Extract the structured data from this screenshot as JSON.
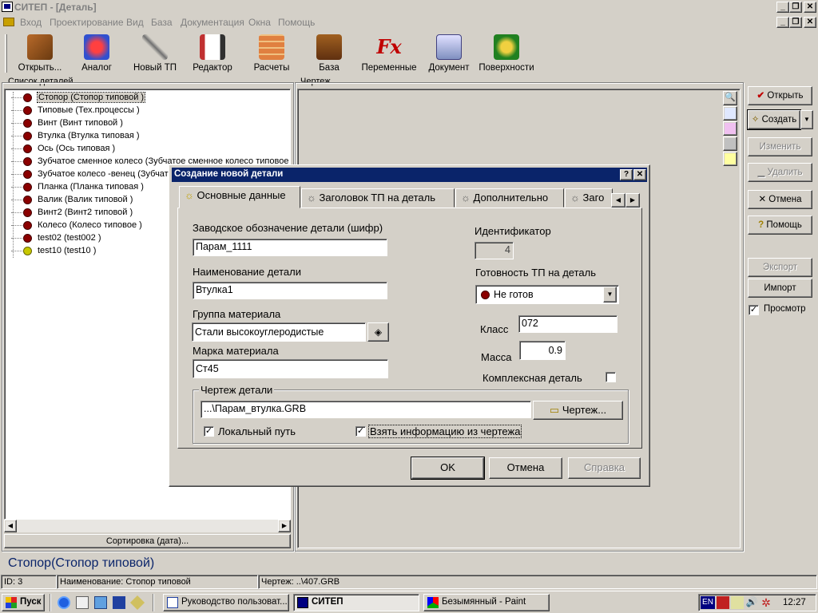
{
  "window": {
    "title": "СИТЕП - [Деталь]"
  },
  "menu": [
    "Вход",
    "Проектирование",
    "Вид",
    "База",
    "Документация",
    "Окна",
    "Помощь"
  ],
  "toolbar": [
    "Открыть...",
    "Аналог",
    "Новый ТП",
    "Редактор",
    "Расчеты",
    "База",
    "Переменные",
    "Документ",
    "Поверхности"
  ],
  "left_panel": {
    "title": "Список деталей",
    "items": [
      {
        "label": "Стопор (Стопор типовой )",
        "status": "red"
      },
      {
        "label": "Типовые (Тех.процессы )",
        "status": "red"
      },
      {
        "label": "Винт (Винт типовой )",
        "status": "red"
      },
      {
        "label": "Втулка (Втулка типовая )",
        "status": "red"
      },
      {
        "label": "Ось (Ось типовая )",
        "status": "red"
      },
      {
        "label": "Зубчатое сменное колесо (Зубчатое сменное колесо типовое",
        "status": "red"
      },
      {
        "label": "Зубчатое колесо -венец (Зубчато",
        "status": "red"
      },
      {
        "label": "Планка (Планка типовая )",
        "status": "red"
      },
      {
        "label": "Валик (Валик типовой )",
        "status": "red"
      },
      {
        "label": "Винт2 (Винт2 типовой )",
        "status": "red"
      },
      {
        "label": "Колесо (Колесо типовое )",
        "status": "red"
      },
      {
        "label": "test02 (test002 )",
        "status": "red"
      },
      {
        "label": "test10 (test10 )",
        "status": "yellow"
      }
    ],
    "sort_button": "Сортировка (дата)..."
  },
  "center_panel": {
    "title": "Чертеж"
  },
  "right_buttons": {
    "open": "Открыть",
    "create": "Создать",
    "change": "Изменить",
    "delete": "Удалить",
    "cancel": "Отмена",
    "help": "Помощь",
    "export": "Экспорт",
    "import": "Импорт",
    "preview": "Просмотр"
  },
  "dialog": {
    "title": "Создание новой детали",
    "tabs": [
      "Основные данные",
      "Заголовок ТП на деталь",
      "Дополнительно",
      "Заго"
    ],
    "code_label": "Заводское обозначение детали (шифр)",
    "code_value": "Парам_1111",
    "id_label": "Идентификатор",
    "id_value": "4",
    "name_label": "Наименование детали",
    "name_value": "Втулка1",
    "readiness_label": "Готовность ТП на деталь",
    "readiness_value": "Не готов",
    "group_label": "Группа материала",
    "group_value": "Стали высокоуглеродистые",
    "class_label": "Класс",
    "class_value": "072",
    "grade_label": "Марка материала",
    "grade_value": "Ст45",
    "mass_label": "Масса",
    "mass_value": "0.9",
    "complex_label": "Комплексная деталь",
    "drawing_group": "Чертеж детали",
    "drawing_path": "...\\Парам_втулка.GRB",
    "drawing_button": "Чертеж...",
    "local_path": "Локальный путь",
    "take_info": "Взять информацию из чертежа",
    "ok": "OK",
    "cancel": "Отмена",
    "help": "Справка"
  },
  "selected_title": "Стопор(Стопор типовой)",
  "status": {
    "id": "ID: 3",
    "name": "Наименование: Стопор типовой",
    "drawing": "Чертеж: ..\\407.GRB"
  },
  "taskbar": {
    "start": "Пуск",
    "tasks": [
      "Руководство пользоват...",
      "СИТЕП",
      "Безымянный - Paint"
    ],
    "lang": "EN",
    "time": "12:27"
  }
}
